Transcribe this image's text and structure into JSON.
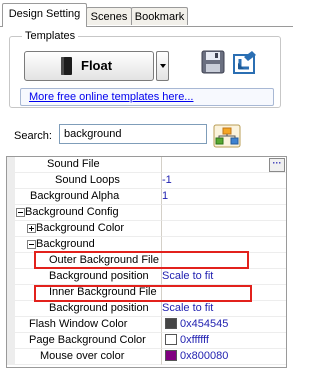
{
  "tabs": [
    {
      "label": "Design Setting"
    },
    {
      "label": "Scenes"
    },
    {
      "label": "Bookmark"
    }
  ],
  "templates": {
    "title": "Templates",
    "selected": "Float",
    "link": "More free online templates here..."
  },
  "search": {
    "label": "Search:",
    "value": "background"
  },
  "properties": [
    {
      "name": "Sound File",
      "value": ""
    },
    {
      "name": "Sound Loops",
      "value": "-1"
    },
    {
      "name": "Background Alpha",
      "value": "1"
    },
    {
      "name": "Background Config",
      "value": ""
    },
    {
      "name": "Background Color",
      "value": ""
    },
    {
      "name": "Background",
      "value": ""
    },
    {
      "name": "Outer Background File",
      "value": ""
    },
    {
      "name": "Background position",
      "value": "Scale to fit"
    },
    {
      "name": "Inner Background File",
      "value": ""
    },
    {
      "name": "Background position",
      "value": "Scale to fit"
    },
    {
      "name": "Flash Window Color",
      "value": "0x454545"
    },
    {
      "name": "Page Background Color",
      "value": "0xffffff"
    },
    {
      "name": "Mouse over color",
      "value": "0x800080"
    }
  ],
  "colors": {
    "flash_window": "#454545",
    "page_background": "#ffffff",
    "mouse_over": "#800080",
    "highlight": "#e2211c"
  }
}
